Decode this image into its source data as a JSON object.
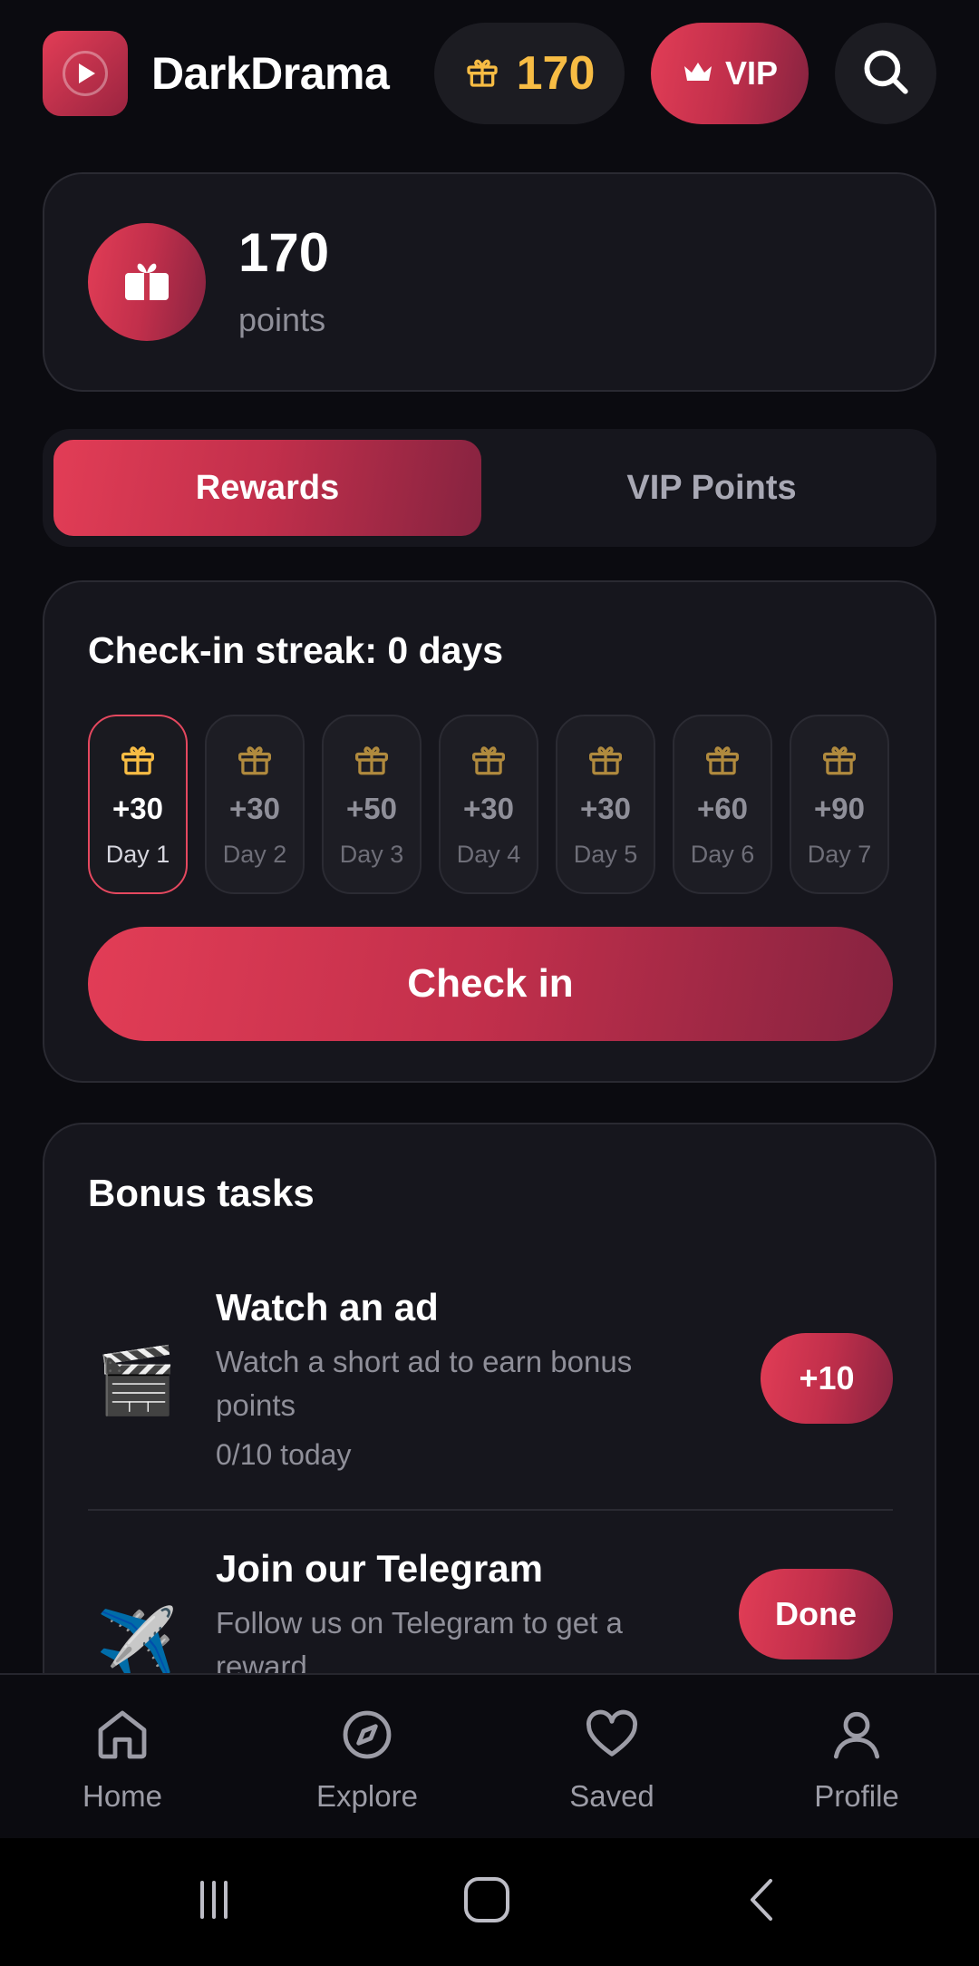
{
  "header": {
    "app_name": "DarkDrama",
    "coins": "170",
    "vip_label": "VIP"
  },
  "points_card": {
    "value": "170",
    "label": "points"
  },
  "tabs": [
    {
      "label": "Rewards",
      "active": true
    },
    {
      "label": "VIP Points",
      "active": false
    }
  ],
  "checkin": {
    "title": "Check-in streak: 0 days",
    "days": [
      {
        "amount": "+30",
        "label": "Day 1",
        "active": true
      },
      {
        "amount": "+30",
        "label": "Day 2",
        "active": false
      },
      {
        "amount": "+50",
        "label": "Day 3",
        "active": false
      },
      {
        "amount": "+30",
        "label": "Day 4",
        "active": false
      },
      {
        "amount": "+30",
        "label": "Day 5",
        "active": false
      },
      {
        "amount": "+60",
        "label": "Day 6",
        "active": false
      },
      {
        "amount": "+90",
        "label": "Day 7",
        "active": false
      }
    ],
    "button_label": "Check in"
  },
  "bonus": {
    "title": "Bonus tasks",
    "tasks": [
      {
        "icon": "🎬",
        "icon_name": "clapperboard-icon",
        "title": "Watch an ad",
        "description": "Watch a short ad to earn bonus points",
        "progress": "0/10 today",
        "button": "+10"
      },
      {
        "icon": "✈️",
        "icon_name": "airplane-icon",
        "title": "Join our Telegram",
        "description": "Follow us on Telegram to get a reward",
        "progress": "",
        "button": "Done"
      }
    ]
  },
  "nav": [
    {
      "label": "Home",
      "icon": "home-icon"
    },
    {
      "label": "Explore",
      "icon": "compass-icon"
    },
    {
      "label": "Saved",
      "icon": "heart-icon"
    },
    {
      "label": "Profile",
      "icon": "user-icon"
    }
  ],
  "colors": {
    "accent": "#e23d56",
    "accent_dark": "#862340",
    "gold": "#f7bc44",
    "background": "#0b0b10",
    "card": "#16161d"
  }
}
